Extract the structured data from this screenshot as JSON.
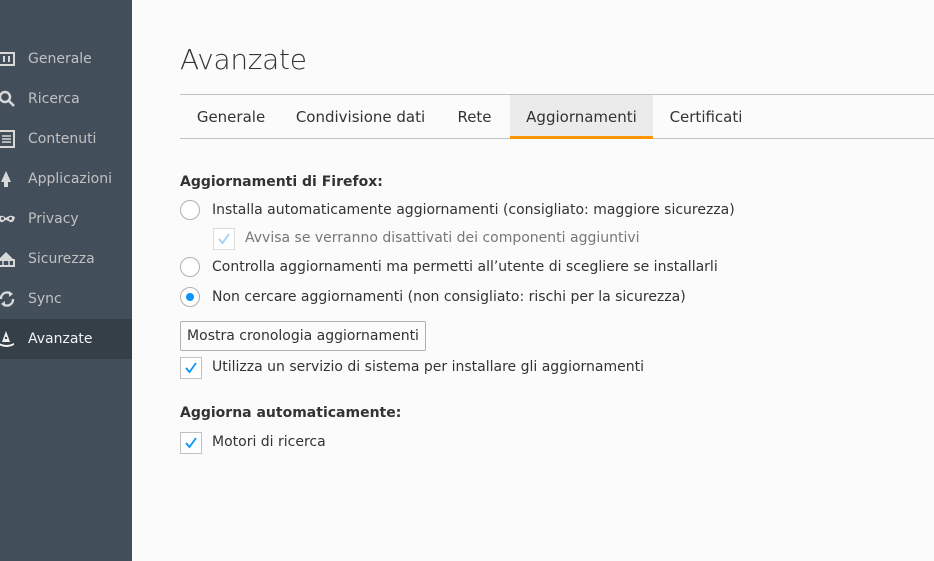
{
  "sidebar": {
    "items": [
      {
        "label": "Generale",
        "icon": "general-icon"
      },
      {
        "label": "Ricerca",
        "icon": "search-icon"
      },
      {
        "label": "Contenuti",
        "icon": "content-icon"
      },
      {
        "label": "Applicazioni",
        "icon": "applications-icon"
      },
      {
        "label": "Privacy",
        "icon": "privacy-mask-icon"
      },
      {
        "label": "Sicurezza",
        "icon": "security-icon"
      },
      {
        "label": "Sync",
        "icon": "sync-icon"
      },
      {
        "label": "Avanzate",
        "icon": "advanced-wizard-hat-icon",
        "active": true
      }
    ]
  },
  "page": {
    "title": "Avanzate"
  },
  "tabs": [
    {
      "label": "Generale"
    },
    {
      "label": "Condivisione dati"
    },
    {
      "label": "Rete"
    },
    {
      "label": "Aggiornamenti",
      "active": true
    },
    {
      "label": "Certificati"
    }
  ],
  "updates": {
    "section_title": "Aggiornamenti di Firefox:",
    "option_auto": "Installa automaticamente aggiornamenti (consigliato: maggiore sicurezza)",
    "option_warn_addons": "Avvisa se verranno disattivati dei componenti aggiuntivi",
    "option_check_only": "Controlla aggiornamenti ma permetti all’utente di scegliere se installarli",
    "option_never": "Non cercare aggiornamenti (non consigliato: rischi per la sicurezza)",
    "selected_option": "option_never",
    "history_button": "Mostra cronologia aggiornamenti",
    "use_service": "Utilizza un servizio di sistema per installare gli aggiornamenti",
    "use_service_checked": true,
    "warn_addons_checked": true,
    "warn_addons_disabled": true
  },
  "auto_update": {
    "section_title": "Aggiorna automaticamente:",
    "search_engines": "Motori di ricerca",
    "search_engines_checked": true
  },
  "colors": {
    "accent": "#ff9500",
    "radio_selected": "#0996f8",
    "check": "#0996f8",
    "sidebar_bg": "#424f5a"
  }
}
